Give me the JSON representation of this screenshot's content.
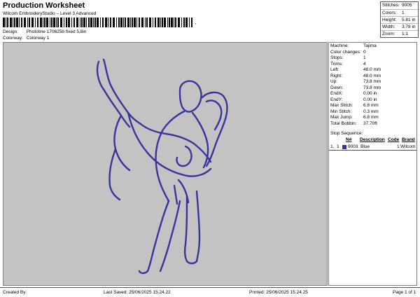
{
  "header": {
    "title": "Production Worksheet",
    "subtitle": "Wilcom EmbroideryStudio – Level 3 Advanced",
    "barcode_suffix": ",",
    "design_label": "Design:",
    "design_value": "Photoline 170625b fixed 5,8in",
    "colorway_label": "Colorway:",
    "colorway_value": "Colorway 1"
  },
  "summary": [
    {
      "label": "Stitches:",
      "value": "9005"
    },
    {
      "label": "Colors:",
      "value": "1"
    },
    {
      "label": "Height:",
      "value": "5.81 in"
    },
    {
      "label": "Width:",
      "value": "3.78 in"
    },
    {
      "label": "Zoom:",
      "value": "1:1"
    }
  ],
  "stats": [
    {
      "label": "Machine:",
      "value": "Tajima"
    },
    {
      "label": "Color changes:",
      "value": "0"
    },
    {
      "label": "Stops:",
      "value": "1"
    },
    {
      "label": "Trims:",
      "value": "4"
    },
    {
      "label": "Left:",
      "value": "48.0 mm"
    },
    {
      "label": "Right:",
      "value": "48.0 mm"
    },
    {
      "label": "Up:",
      "value": "73.8 mm"
    },
    {
      "label": "Down:",
      "value": "73.8 mm"
    },
    {
      "label": "EndX:",
      "value": "0.00 in"
    },
    {
      "label": "EndY:",
      "value": "0.00 in"
    },
    {
      "label": "Max Stitch:",
      "value": "6.8 mm"
    },
    {
      "label": "Min Stitch:",
      "value": "0.3 mm"
    },
    {
      "label": "Max Jump:",
      "value": "6.8 mm"
    },
    {
      "label": "Total Bobbin:",
      "value": "37.70ft"
    }
  ],
  "sequence": {
    "title": "Stop Sequence:",
    "columns": [
      "N#",
      "Description",
      "Code",
      "Brand"
    ],
    "rows": [
      {
        "index": "1.",
        "stop": "1",
        "number": "9003",
        "description": "Blue",
        "code": "1",
        "brand": "Wilcom",
        "color": "#333399"
      }
    ]
  },
  "design": {
    "thread_color": "#3a3399",
    "background": "#c3c3c3"
  },
  "footer": {
    "created_by": "Created By:",
    "last_saved": "Last Saved: 25/06/2025 15.24.22",
    "printed": "Printed: 25/06/2025 15.24.25",
    "page": "Page 1 of 1"
  }
}
